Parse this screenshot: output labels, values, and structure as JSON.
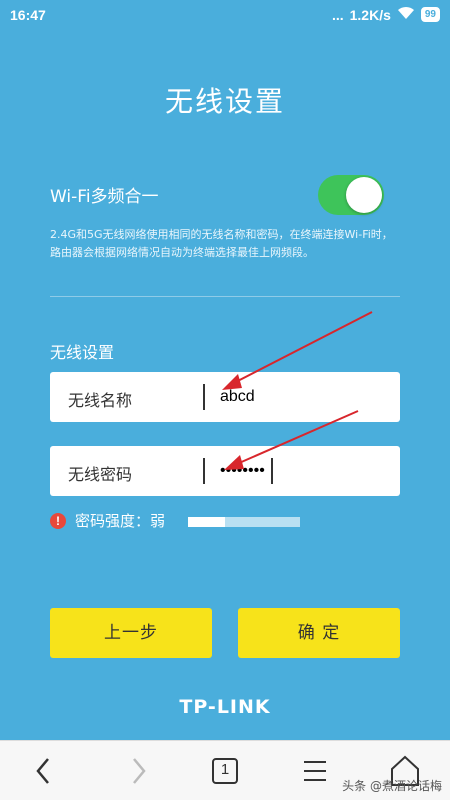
{
  "statusbar": {
    "time": "16:47",
    "dots": "...",
    "speed": "1.2K/s",
    "battery": "99"
  },
  "page": {
    "title": "无线设置"
  },
  "wifi_merge": {
    "label": "Wi-Fi多频合一",
    "enabled": true,
    "description": "2.4G和5G无线网络使用相同的无线名称和密码，在终端连接Wi-Fi时，路由器会根据网络情况自动为终端选择最佳上网频段。"
  },
  "wireless": {
    "section_label": "无线设置",
    "name_label": "无线名称",
    "name_value": "abcd",
    "password_label": "无线密码",
    "password_value": "••••••••"
  },
  "strength": {
    "icon": "!",
    "label": "密码强度：弱",
    "level_fraction": 0.33
  },
  "buttons": {
    "prev": "上一步",
    "confirm": "确 定"
  },
  "brand": {
    "logo": "TP-LINK"
  },
  "navbar": {
    "tab_count": "1",
    "watermark": "头条 @煮酒论话梅"
  },
  "colors": {
    "background": "#4aaedc",
    "toggle_on": "#3ec45a",
    "button": "#f7e31a",
    "warning": "#e8483b",
    "arrow": "#d8262c"
  },
  "icons": {
    "status": [
      "wifi-icon",
      "battery-icon"
    ],
    "nav": [
      "back-icon",
      "forward-icon",
      "tabs-icon",
      "menu-icon",
      "home-icon"
    ]
  }
}
